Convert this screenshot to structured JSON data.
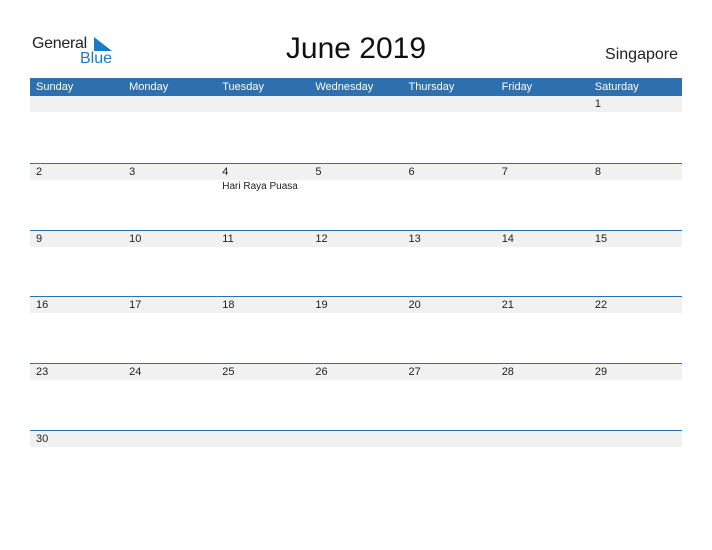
{
  "logo": {
    "line1": "General",
    "line2": "Blue",
    "accent": "#1f7bc1"
  },
  "title": "June 2019",
  "country": "Singapore",
  "header_color": "#2e6fad",
  "weekdays": [
    "Sunday",
    "Monday",
    "Tuesday",
    "Wednesday",
    "Thursday",
    "Friday",
    "Saturday"
  ],
  "weeks": [
    [
      {
        "d": ""
      },
      {
        "d": ""
      },
      {
        "d": ""
      },
      {
        "d": ""
      },
      {
        "d": ""
      },
      {
        "d": ""
      },
      {
        "d": "1"
      }
    ],
    [
      {
        "d": "2"
      },
      {
        "d": "3"
      },
      {
        "d": "4",
        "event": "Hari Raya Puasa"
      },
      {
        "d": "5"
      },
      {
        "d": "6"
      },
      {
        "d": "7"
      },
      {
        "d": "8"
      }
    ],
    [
      {
        "d": "9"
      },
      {
        "d": "10"
      },
      {
        "d": "11"
      },
      {
        "d": "12"
      },
      {
        "d": "13"
      },
      {
        "d": "14"
      },
      {
        "d": "15"
      }
    ],
    [
      {
        "d": "16"
      },
      {
        "d": "17"
      },
      {
        "d": "18"
      },
      {
        "d": "19"
      },
      {
        "d": "20"
      },
      {
        "d": "21"
      },
      {
        "d": "22"
      }
    ],
    [
      {
        "d": "23"
      },
      {
        "d": "24"
      },
      {
        "d": "25"
      },
      {
        "d": "26"
      },
      {
        "d": "27"
      },
      {
        "d": "28"
      },
      {
        "d": "29"
      }
    ],
    [
      {
        "d": "30"
      },
      {
        "d": ""
      },
      {
        "d": ""
      },
      {
        "d": ""
      },
      {
        "d": ""
      },
      {
        "d": ""
      },
      {
        "d": ""
      }
    ]
  ]
}
